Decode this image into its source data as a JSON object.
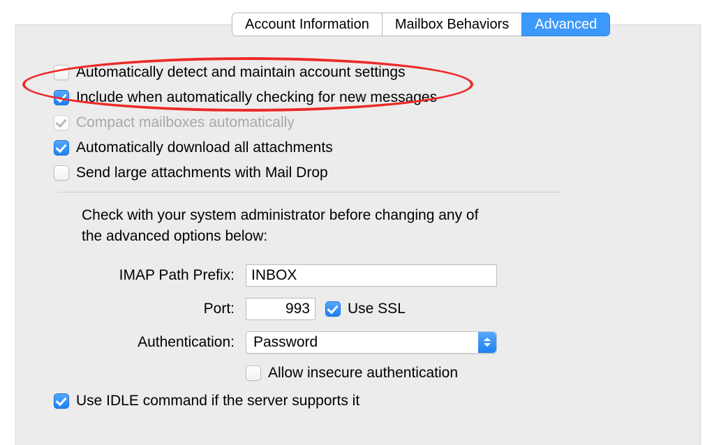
{
  "tabs": {
    "account_info": "Account Information",
    "mailbox_behaviors": "Mailbox Behaviors",
    "advanced": "Advanced"
  },
  "checkboxes": {
    "auto_detect": "Automatically detect and maintain account settings",
    "include_checking": "Include when automatically checking for new messages",
    "compact": "Compact mailboxes automatically",
    "download_attach": "Automatically download all attachments",
    "mail_drop": "Send large attachments with Mail Drop"
  },
  "advanced_note": "Check with your system administrator before changing any of the advanced options below:",
  "form": {
    "imap_prefix_label": "IMAP Path Prefix:",
    "imap_prefix_value": "INBOX",
    "port_label": "Port:",
    "port_value": "993",
    "use_ssl_label": "Use SSL",
    "auth_label": "Authentication:",
    "auth_value": "Password",
    "allow_insecure": "Allow insecure authentication",
    "use_idle": "Use IDLE command if the server supports it"
  }
}
